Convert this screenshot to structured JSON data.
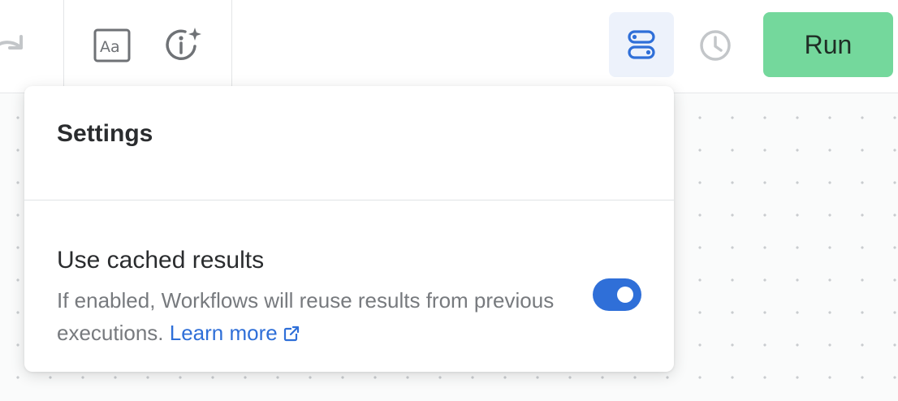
{
  "toolbar": {
    "redo_icon": "redo-icon",
    "font_icon": "font-aa-icon",
    "info_icon": "info-sparkle-icon",
    "settings_icon": "settings-toggles-icon",
    "history_icon": "clock-icon",
    "run_label": "Run"
  },
  "settings_popover": {
    "title": "Settings",
    "option": {
      "title": "Use cached results",
      "description": "If enabled, Workflows will reuse results from previous executions.",
      "link_label": "Learn more",
      "link_icon": "external-link-icon",
      "enabled": true
    }
  },
  "colors": {
    "accent": "#2f6fd8",
    "run_button": "#74d89c",
    "active_button_bg": "#edf2fb",
    "muted_text": "#777a7e"
  }
}
